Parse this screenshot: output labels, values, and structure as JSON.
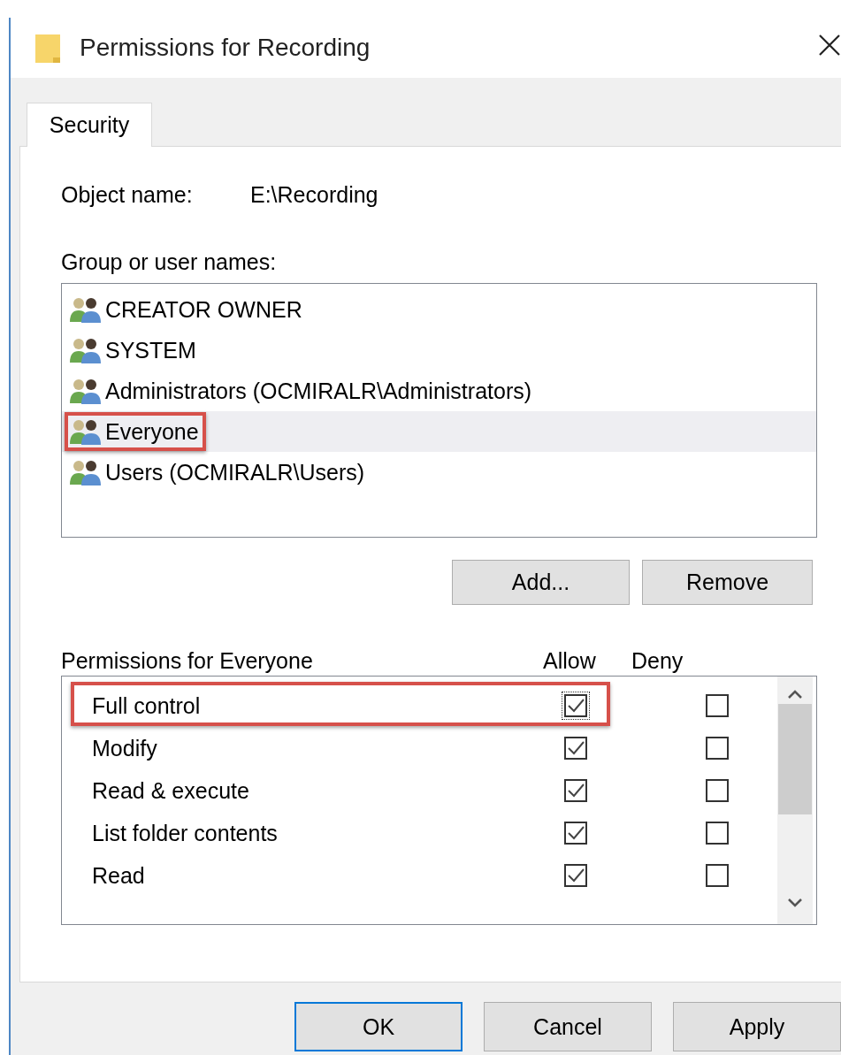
{
  "window": {
    "title": "Permissions for Recording"
  },
  "tabs": [
    {
      "label": "Security",
      "selected": true
    }
  ],
  "object_name": {
    "label": "Object name:",
    "value": "E:\\Recording"
  },
  "groups": {
    "label": "Group or user names:",
    "items": [
      {
        "name": "CREATOR OWNER",
        "selected": false,
        "highlighted": false
      },
      {
        "name": "SYSTEM",
        "selected": false,
        "highlighted": false
      },
      {
        "name": "Administrators (OCMIRALR\\Administrators)",
        "selected": false,
        "highlighted": false
      },
      {
        "name": "Everyone",
        "selected": true,
        "highlighted": true
      },
      {
        "name": "Users (OCMIRALR\\Users)",
        "selected": false,
        "highlighted": false
      }
    ]
  },
  "group_buttons": [
    "Add...",
    "Remove"
  ],
  "permissions": {
    "label": "Permissions for Everyone",
    "columns": [
      "Allow",
      "Deny"
    ],
    "rows": [
      {
        "name": "Full control",
        "allow": true,
        "deny": false,
        "focused": true,
        "highlighted": true
      },
      {
        "name": "Modify",
        "allow": true,
        "deny": false,
        "focused": false,
        "highlighted": false
      },
      {
        "name": "Read & execute",
        "allow": true,
        "deny": false,
        "focused": false,
        "highlighted": false
      },
      {
        "name": "List folder contents",
        "allow": true,
        "deny": false,
        "focused": false,
        "highlighted": false
      },
      {
        "name": "Read",
        "allow": true,
        "deny": false,
        "focused": false,
        "highlighted": false
      }
    ]
  },
  "buttons": [
    {
      "label": "OK",
      "default": true
    },
    {
      "label": "Cancel",
      "default": false
    },
    {
      "label": "Apply",
      "default": false
    }
  ]
}
